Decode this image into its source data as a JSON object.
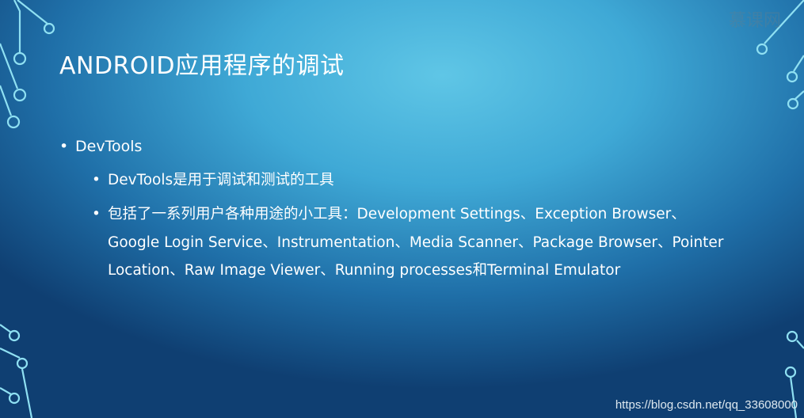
{
  "slide": {
    "title": "ANDROID应用程序的调试",
    "bullets": [
      {
        "text": "DevTools",
        "children": [
          {
            "text": "DevTools是用于调试和测试的工具"
          },
          {
            "text": "包括了一系列用户各种用途的小工具：Development Settings、Exception Browser、Google Login Service、Instrumentation、Media Scanner、Package Browser、Pointer Location、Raw Image Viewer、Running processes和Terminal Emulator"
          }
        ]
      }
    ],
    "bullet_glyph": "•"
  },
  "logo": {
    "text": "慕课网"
  },
  "watermark": "https://blog.csdn.net/qq_33608000",
  "colors": {
    "background": "#3fa9d6",
    "text": "#ffffff",
    "circuit": "#8fe0f2"
  }
}
